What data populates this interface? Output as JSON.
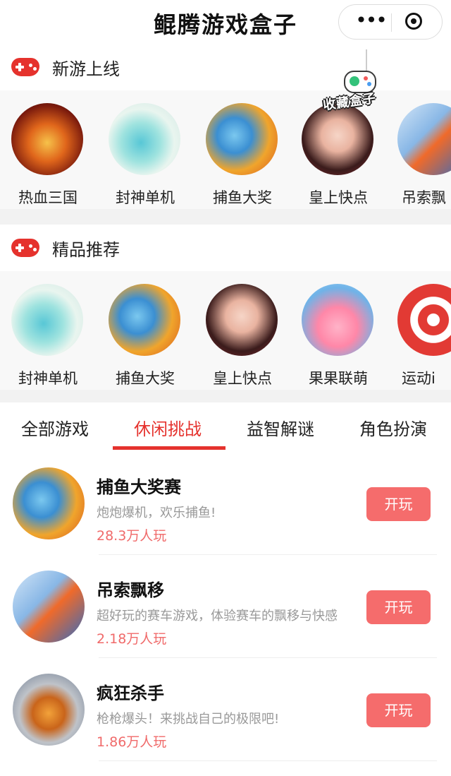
{
  "header": {
    "title": "鲲腾游戏盒子",
    "more_icon": "ellipsis-icon",
    "close_icon": "target-icon"
  },
  "sections": [
    {
      "title": "新游上线",
      "icon": "gamepad-icon",
      "items": [
        {
          "label": "热血三国",
          "avatar": "fire-warrior"
        },
        {
          "label": "封神单机",
          "avatar": "dragon"
        },
        {
          "label": "捕鱼大奖",
          "avatar": "shark"
        },
        {
          "label": "皇上快点",
          "avatar": "girl"
        },
        {
          "label": "吊索飘",
          "avatar": "car"
        }
      ]
    },
    {
      "title": "精品推荐",
      "icon": "gamepad-icon",
      "items": [
        {
          "label": "封神单机",
          "avatar": "dragon"
        },
        {
          "label": "捕鱼大奖",
          "avatar": "shark"
        },
        {
          "label": "皇上快点",
          "avatar": "girl"
        },
        {
          "label": "果果联萌",
          "avatar": "blob"
        },
        {
          "label": "运动i",
          "avatar": "target"
        }
      ]
    }
  ],
  "favorite_badge": {
    "label": "收藏盒子"
  },
  "tabs": [
    {
      "label": "全部游戏",
      "active": false
    },
    {
      "label": "休闲挑战",
      "active": true
    },
    {
      "label": "益智解谜",
      "active": false
    },
    {
      "label": "角色扮演",
      "active": false
    }
  ],
  "games": [
    {
      "name": "捕鱼大奖赛",
      "desc": "炮炮爆机，欢乐捕鱼!",
      "players": "28.3万人玩",
      "button": "开玩"
    },
    {
      "name": "吊索飘移",
      "desc": "超好玩的赛车游戏，体验赛车的飘移与快感",
      "players": "2.18万人玩",
      "button": "开玩"
    },
    {
      "name": "疯狂杀手",
      "desc": "枪枪爆头！来挑战自己的极限吧!",
      "players": "1.86万人玩",
      "button": "开玩"
    }
  ],
  "colors": {
    "accent": "#e5322d",
    "button": "#f56c6c",
    "players": "#f06a6a"
  }
}
